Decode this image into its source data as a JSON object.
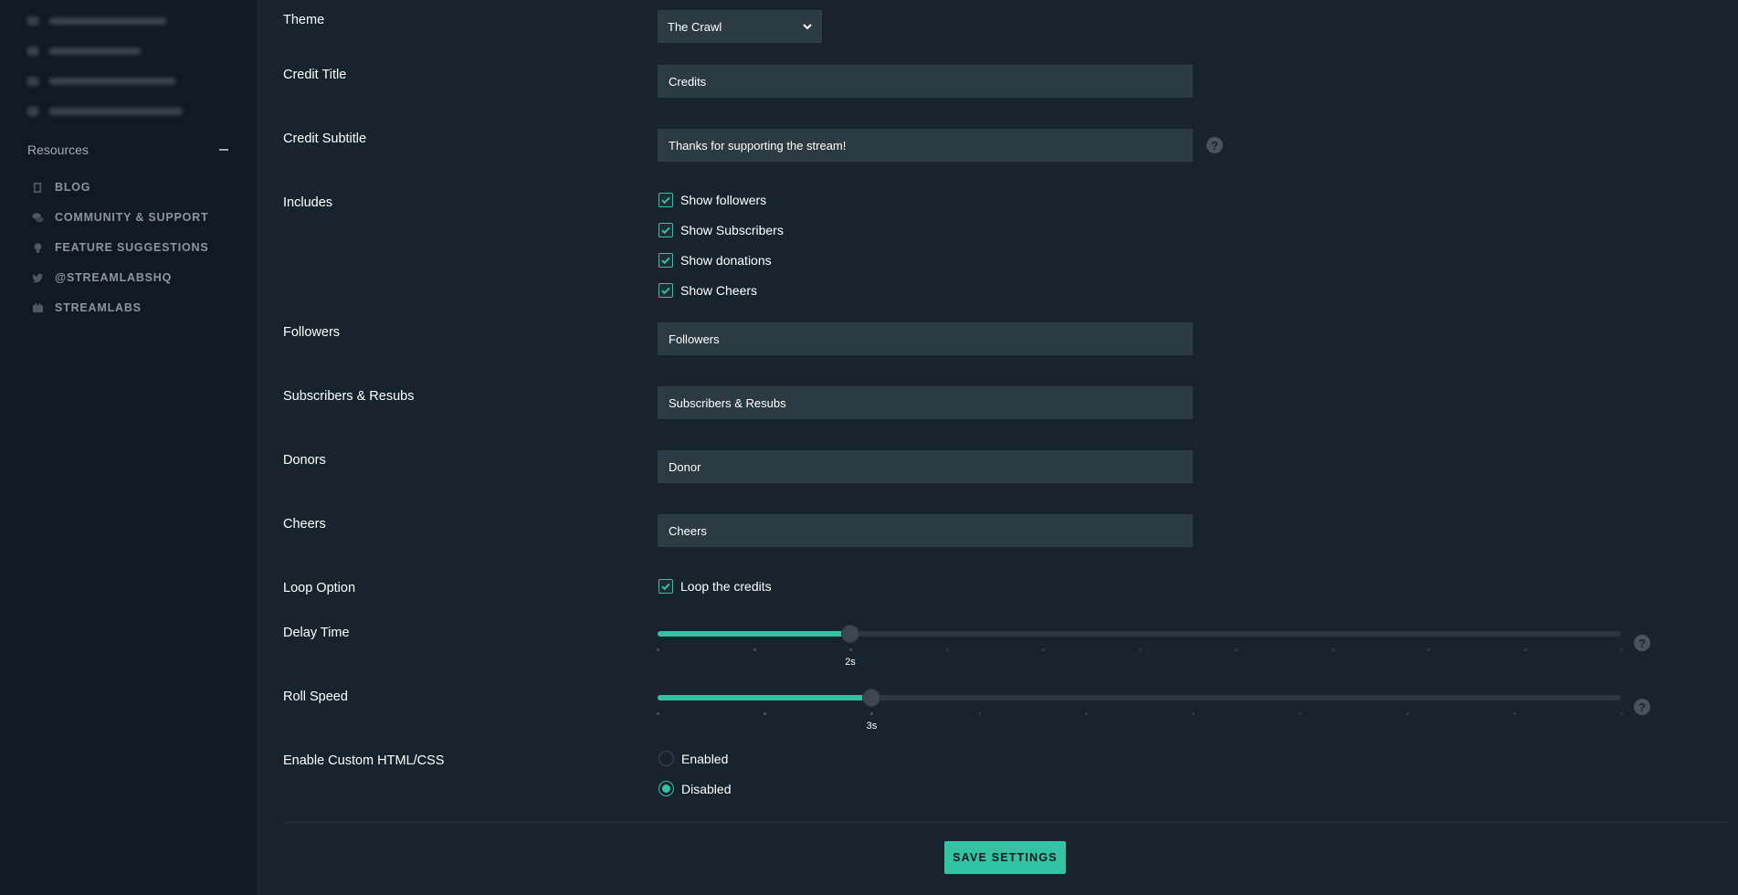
{
  "sidebar": {
    "resources_title": "Resources",
    "links": [
      {
        "label": "BLOG",
        "icon": "book-icon"
      },
      {
        "label": "COMMUNITY & SUPPORT",
        "icon": "chat-bubbles-icon"
      },
      {
        "label": "FEATURE SUGGESTIONS",
        "icon": "lightbulb-icon"
      },
      {
        "label": "@STREAMLABSHQ",
        "icon": "twitter-icon"
      },
      {
        "label": "STREAMLABS",
        "icon": "youtube-icon"
      }
    ]
  },
  "form": {
    "theme": {
      "label": "Theme",
      "value": "The Crawl"
    },
    "credit_title": {
      "label": "Credit Title",
      "value": "Credits"
    },
    "credit_subtitle": {
      "label": "Credit Subtitle",
      "value": "Thanks for supporting the stream!"
    },
    "includes": {
      "label": "Includes",
      "options": [
        {
          "label": "Show followers",
          "checked": true
        },
        {
          "label": "Show Subscribers",
          "checked": true
        },
        {
          "label": "Show donations",
          "checked": true
        },
        {
          "label": "Show Cheers",
          "checked": true
        }
      ]
    },
    "followers": {
      "label": "Followers",
      "value": "Followers"
    },
    "subscribers": {
      "label": "Subscribers & Resubs",
      "value": "Subscribers & Resubs"
    },
    "donors": {
      "label": "Donors",
      "value": "Donor"
    },
    "cheers": {
      "label": "Cheers",
      "value": "Cheers"
    },
    "loop": {
      "label": "Loop Option",
      "option": "Loop the credits",
      "checked": true
    },
    "delay_time": {
      "label": "Delay Time",
      "value_label": "2s",
      "value": 2,
      "min": 0,
      "max": 10
    },
    "roll_speed": {
      "label": "Roll Speed",
      "value_label": "3s",
      "value": 3,
      "min": 1,
      "max": 10
    },
    "custom_html": {
      "label": "Enable Custom HTML/CSS",
      "options": [
        {
          "label": "Enabled",
          "selected": false
        },
        {
          "label": "Disabled",
          "selected": true
        }
      ]
    },
    "help_glyph": "?",
    "save_label": "SAVE SETTINGS"
  },
  "colors": {
    "accent": "#31c3a2",
    "background": "#17242d",
    "sidebar": "#0f1b22",
    "input": "#2c3a42"
  }
}
